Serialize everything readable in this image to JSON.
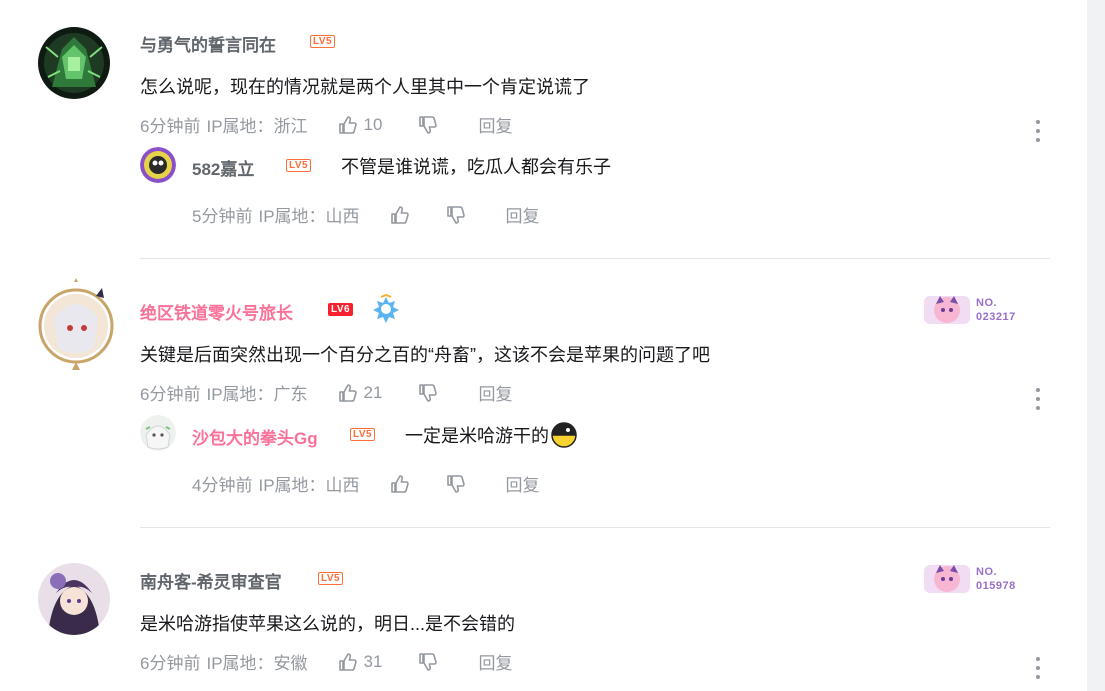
{
  "comments": [
    {
      "username": "与勇气的誓言同在",
      "level": "LV5",
      "content": "怎么说呢，现在的情况就是两个人里其中一个肯定说谎了",
      "time": "6分钟前",
      "ip": "IP属地：浙江",
      "likes": "10",
      "reply_label": "回复",
      "replies": [
        {
          "username": "582嘉立",
          "level": "LV5",
          "content": "不管是谁说谎，吃瓜人都会有乐子",
          "time": "5分钟前",
          "ip": "IP属地：山西",
          "reply_label": "回复"
        }
      ]
    },
    {
      "username": "绝区铁道零火号旅长",
      "level": "LV6",
      "content": "关键是后面突然出现一个百分之百的“舟畜”，这该不会是苹果的问题了吧",
      "time": "6分钟前",
      "ip": "IP属地：广东",
      "likes": "21",
      "reply_label": "回复",
      "fan_badge": {
        "line1": "NO.",
        "line2": "023217"
      },
      "replies": [
        {
          "username": "沙包大的拳头Gg",
          "level": "LV5",
          "content": "一定是米哈游干的",
          "time": "4分钟前",
          "ip": "IP属地：山西",
          "reply_label": "回复"
        }
      ]
    },
    {
      "username": "南舟客-希灵审查官",
      "level": "LV5",
      "content": "是米哈游指使苹果这么说的，明日...是不会错的",
      "time": "6分钟前",
      "ip": "IP属地：安徽",
      "likes": "31",
      "reply_label": "回复",
      "fan_badge": {
        "line1": "NO.",
        "line2": "015978"
      }
    }
  ],
  "colors": {
    "vip_name": "#fb7299",
    "normal_name": "#61666d",
    "meta": "#9499a0",
    "level_badge": "#ff6d3a"
  },
  "icons": {
    "like": "thumb-up-icon",
    "dislike": "thumb-down-icon",
    "more": "more-vertical-icon"
  }
}
